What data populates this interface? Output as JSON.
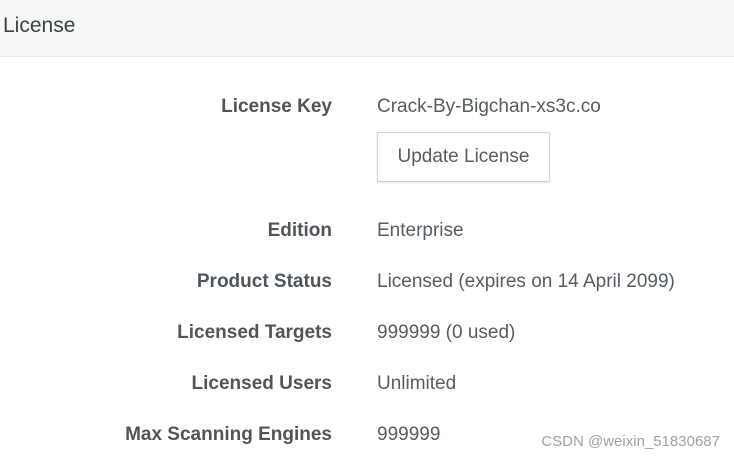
{
  "header": {
    "title": "License"
  },
  "license": {
    "rows": [
      {
        "label": "License Key",
        "value": "Crack-By-Bigchan-xs3c.co"
      },
      {
        "label": "Edition",
        "value": "Enterprise"
      },
      {
        "label": "Product Status",
        "value": "Licensed (expires on 14 April 2099)"
      },
      {
        "label": "Licensed Targets",
        "value": "999999 (0 used)"
      },
      {
        "label": "Licensed Users",
        "value": "Unlimited"
      },
      {
        "label": "Max Scanning Engines",
        "value": "999999"
      }
    ],
    "update_button_label": "Update License"
  },
  "watermark": {
    "text": "CSDN @weixin_51830687"
  }
}
